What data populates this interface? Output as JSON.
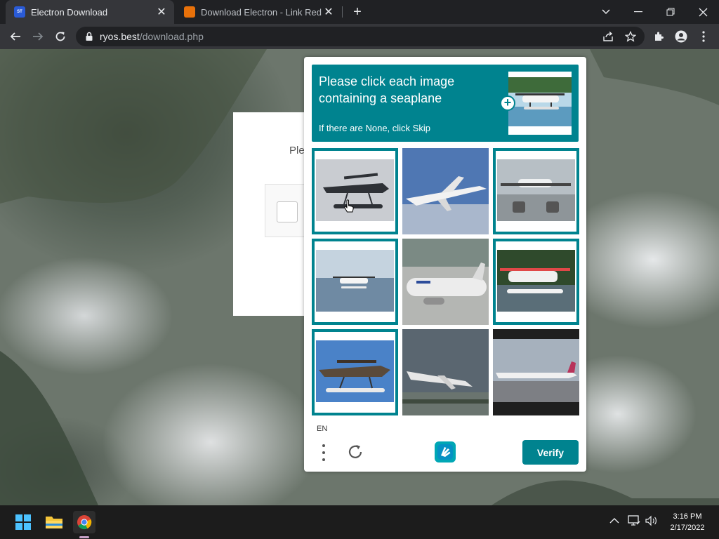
{
  "browser": {
    "tabs": [
      {
        "title": "Electron Download",
        "active": true,
        "favicon": "electron-favicon"
      },
      {
        "title": "Download Electron - Link Redirec",
        "active": false,
        "favicon": "link-redirect-favicon"
      }
    ],
    "new_tab_symbol": "+",
    "url_host": "ryos.best",
    "url_path": "/download.php",
    "icons": [
      "back-icon",
      "forward-icon",
      "reload-icon",
      "lock-icon",
      "share-icon",
      "star-icon",
      "extensions-icon",
      "profile-icon",
      "kebab-menu-icon"
    ],
    "window_controls": [
      "minimize-icon",
      "restore-icon",
      "close-icon",
      "tab-list-icon"
    ]
  },
  "page": {
    "background_text": "Ple"
  },
  "captcha": {
    "accent_color": "#00838f",
    "prompt": "Please click each image containing a seaplane",
    "subprompt": "If there are None, click Skip",
    "language": "EN",
    "verify_label": "Verify",
    "tiles": [
      {
        "kind": "seaplane",
        "selected": true
      },
      {
        "kind": "airliner",
        "selected": false
      },
      {
        "kind": "seaplane",
        "selected": true
      },
      {
        "kind": "seaplane",
        "selected": true
      },
      {
        "kind": "airliner",
        "selected": false
      },
      {
        "kind": "seaplane",
        "selected": true
      },
      {
        "kind": "seaplane",
        "selected": true
      },
      {
        "kind": "airliner",
        "selected": false
      },
      {
        "kind": "airliner",
        "selected": false
      }
    ]
  },
  "taskbar": {
    "apps": [
      "windows-start-icon",
      "file-explorer-icon",
      "chrome-icon"
    ],
    "time": "3:16 PM",
    "date": "2/17/2022"
  }
}
